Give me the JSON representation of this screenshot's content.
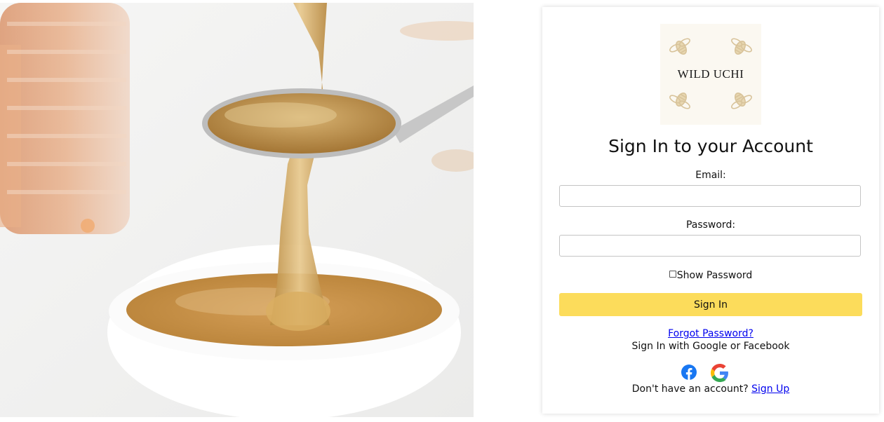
{
  "brand": {
    "logo_text": "WILD UCHI",
    "logo_color": "#d8c39a",
    "accent_color": "#fcdc5b"
  },
  "hero": {
    "icon": "honey-spoon-photo"
  },
  "form": {
    "heading": "Sign In to your Account",
    "email_label": "Email:",
    "email_value": "",
    "password_label": "Password:",
    "password_value": "",
    "show_password_label": "Show Password",
    "show_password_checked": false,
    "submit_label": "Sign In"
  },
  "links": {
    "forgot_password": "Forgot Password?",
    "social_prompt": "Sign In with Google or Facebook",
    "no_account_text": "Don't have an account?",
    "signup_label": "Sign Up"
  },
  "social": {
    "facebook_icon": "facebook-icon",
    "google_icon": "google-icon",
    "facebook_color": "#1877f2"
  }
}
